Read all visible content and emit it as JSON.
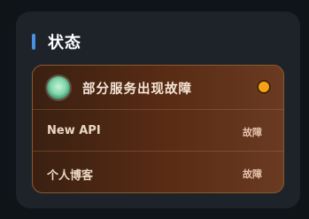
{
  "section": {
    "title": "状态",
    "accent_color": "#4a90e2"
  },
  "status_card": {
    "headline": "部分服务出现故障",
    "indicator_color": "#f5a216",
    "services": [
      {
        "name": "New API",
        "status": "故障"
      },
      {
        "name": "个人博客",
        "status": "故障"
      }
    ]
  }
}
